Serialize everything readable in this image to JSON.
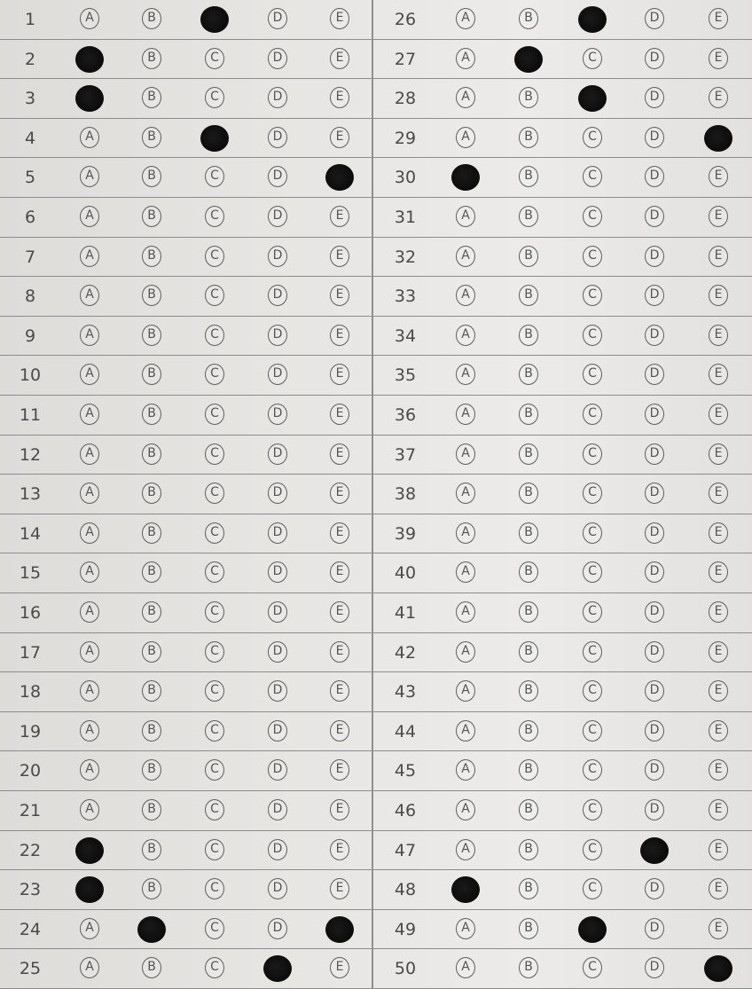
{
  "sheet": {
    "choices": [
      "A",
      "B",
      "C",
      "D",
      "E"
    ],
    "left_column": [
      {
        "number": "1",
        "marked": "C"
      },
      {
        "number": "2",
        "marked": "A"
      },
      {
        "number": "3",
        "marked": "A"
      },
      {
        "number": "4",
        "marked": "C"
      },
      {
        "number": "5",
        "marked": "E"
      },
      {
        "number": "6",
        "marked": null
      },
      {
        "number": "7",
        "marked": null
      },
      {
        "number": "8",
        "marked": null
      },
      {
        "number": "9",
        "marked": null
      },
      {
        "number": "10",
        "marked": null
      },
      {
        "number": "11",
        "marked": null
      },
      {
        "number": "12",
        "marked": null
      },
      {
        "number": "13",
        "marked": null
      },
      {
        "number": "14",
        "marked": null
      },
      {
        "number": "15",
        "marked": null
      },
      {
        "number": "16",
        "marked": null
      },
      {
        "number": "17",
        "marked": null
      },
      {
        "number": "18",
        "marked": null
      },
      {
        "number": "19",
        "marked": null
      },
      {
        "number": "20",
        "marked": null
      },
      {
        "number": "21",
        "marked": null
      },
      {
        "number": "22",
        "marked": "A"
      },
      {
        "number": "23",
        "marked": "A"
      },
      {
        "number": "24",
        "marked": [
          "B",
          "E"
        ]
      },
      {
        "number": "25",
        "marked": "D"
      }
    ],
    "right_column": [
      {
        "number": "26",
        "marked": "C"
      },
      {
        "number": "27",
        "marked": "B"
      },
      {
        "number": "28",
        "marked": "C"
      },
      {
        "number": "29",
        "marked": "E"
      },
      {
        "number": "30",
        "marked": "A"
      },
      {
        "number": "31",
        "marked": null
      },
      {
        "number": "32",
        "marked": null
      },
      {
        "number": "33",
        "marked": null
      },
      {
        "number": "34",
        "marked": null
      },
      {
        "number": "35",
        "marked": null
      },
      {
        "number": "36",
        "marked": null
      },
      {
        "number": "37",
        "marked": null
      },
      {
        "number": "38",
        "marked": null
      },
      {
        "number": "39",
        "marked": null
      },
      {
        "number": "40",
        "marked": null
      },
      {
        "number": "41",
        "marked": null
      },
      {
        "number": "42",
        "marked": null
      },
      {
        "number": "43",
        "marked": null
      },
      {
        "number": "44",
        "marked": null
      },
      {
        "number": "45",
        "marked": null
      },
      {
        "number": "46",
        "marked": null
      },
      {
        "number": "47",
        "marked": "D"
      },
      {
        "number": "48",
        "marked": "A"
      },
      {
        "number": "49",
        "marked": "C"
      },
      {
        "number": "50",
        "marked": "E"
      }
    ]
  },
  "colors": {
    "paper": "#e7e5e2",
    "ink": "#0b0b0b",
    "rule": "#8c8c8c"
  }
}
